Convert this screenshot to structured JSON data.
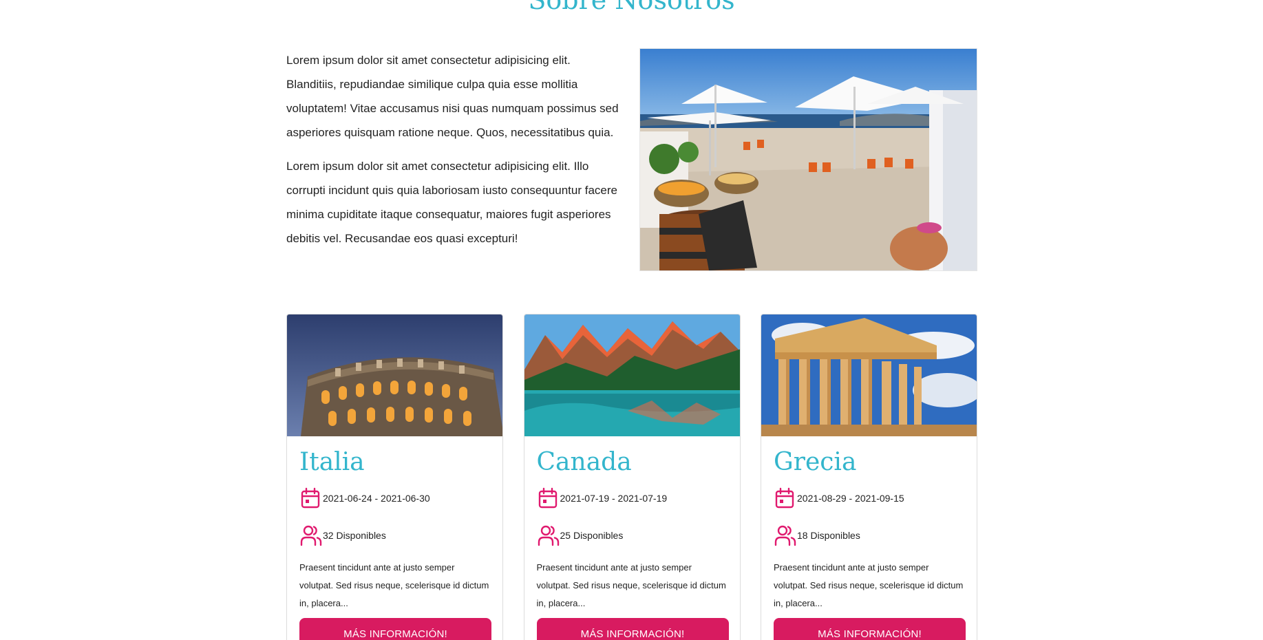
{
  "about": {
    "title": "Sobre Nosotros",
    "paragraphs": [
      "Lorem ipsum dolor sit amet consectetur adipisicing elit. Blanditiis, repudiandae similique culpa quia esse mollitia voluptatem! Vitae accusamus nisi quas numquam possimus sed asperiores quisquam ratione neque. Quos, necessitatibus quia.",
      "Lorem ipsum dolor sit amet consectetur adipisicing elit. Illo corrupti incidunt quis quia laboriosam iusto consequuntur facere minima cupiditate itaque consequatur, maiores fugit asperiores debitis vel. Recusandae eos quasi excepturi!"
    ]
  },
  "colors": {
    "accent": "#33b5cc",
    "brand": "#d81b60"
  },
  "icons": {
    "date": "calendar-icon",
    "seats": "users-icon"
  },
  "cards": [
    {
      "title": "Italia",
      "dates": "2021-06-24 - 2021-06-30",
      "available": "32 Disponibles",
      "description": "Praesent tincidunt ante at justo semper volutpat. Sed risus neque, scelerisque id dictum in, placera...",
      "button": "Más información!"
    },
    {
      "title": "Canada",
      "dates": "2021-07-19 - 2021-07-19",
      "available": "25 Disponibles",
      "description": "Praesent tincidunt ante at justo semper volutpat. Sed risus neque, scelerisque id dictum in, placera...",
      "button": "Más información!"
    },
    {
      "title": "Grecia",
      "dates": "2021-08-29 - 2021-09-15",
      "available": "18 Disponibles",
      "description": "Praesent tincidunt ante at justo semper volutpat. Sed risus neque, scelerisque id dictum in, placera...",
      "button": "Más información!"
    }
  ]
}
